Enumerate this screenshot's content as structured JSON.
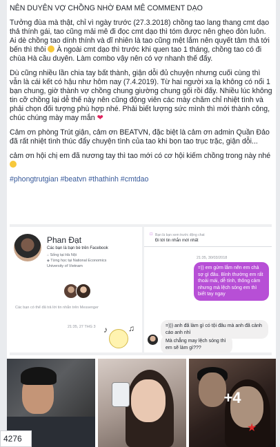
{
  "post": {
    "title_line": "NÊN DUYÊN VỢ CHỒNG NHỜ ĐAM MÊ COMMENT DẠO",
    "paragraphs": [
      "Tưởng đùa mà thật, chỉ vì ngày trước (27.3.2018) chồng tao lang thang cmt dạo thả thính gái, tao cũng mải mê đi đọc cmt dạo thì tóm được nên ghẹo đòn luôn. Ai dè chồng tao dính thính và dĩ nhiên là tao cũng mệt lắm nên quyết tâm thả tới bến thì thôi",
      "À ngoài cmt dạo thì trước khi quen tao 1 tháng, chồng tao có đi chùa Hà cầu duyên. Làm combo vậy nên có vợ nhanh thế đấy.",
      "Dù cũng nhiều lần chia tay bất thành, giận dỗi đủ chuyện nhưng cuối cùng thì vẫn là cái kết có hậu như hôm nay (7.4.2019). Từ hai người xa lạ không có nổi 1 bạn chung, giờ thành vợ chồng chung giường chung gối rồi đấy. Nhiều lúc không tin cỡ chồng lại dễ thế này nên cũng động viên các mày chăm chỉ nhiệt tình và phải chọn đối tượng phù hợp nhé. Phải biết lượng sức mình thì mới thành công, chúc chúng mày may mắn",
      "Cảm ơn phòng Trút giận, cảm ơn BEATVN, đặc biệt là cảm ơn admin Quần Đảo đã rất nhiệt tình thúc đẩy chuyện tình của tao khi bọn tao trục trặc, giận dỗi...",
      "cảm ơn hội chị em đã nương tay thì tao mới có cơ hội kiếm chồng trong này nhé"
    ],
    "hashtags": "#phongtrutgian #beatvn #thathinh #cmtdao"
  },
  "fb_profile": {
    "name": "Phan Đạt",
    "friends_line": "Các bạn là bạn bè trên Facebook",
    "lives": "Sống tại Hà Nội",
    "studied_1": "Từng học tại National Economics",
    "studied_2": "University of Vietnam",
    "note": "Các bạn có thể đã trả lời tin nhắn trên Messenger",
    "time": "21:35, 27 THG 3",
    "sticker_icon": "cat-sticker-icon"
  },
  "messenger": {
    "header_line1": "Bạn là bạn xem trước động chat",
    "header_line2": "Đi tới tin nhắn mới nhất",
    "time": "21:35, 30/03/2018",
    "my_message": "=)) em gửm lắm nên em chả sợ gì đâu. Bình thường em rất thoải mái, dễ tính, thông cảm nhưng mà lệch sóng em thì biết tay ngay",
    "reply_1": "=))) anh đã làm gì có tội đâu mà anh đã cảnh cáo anh nhỉ",
    "reply_2": "Mà chẳng may lệch sóng thì em sẽ làm gì???",
    "accent_color": "#b74fd6"
  },
  "photos": {
    "more_count": "+4"
  },
  "counter": "4276"
}
